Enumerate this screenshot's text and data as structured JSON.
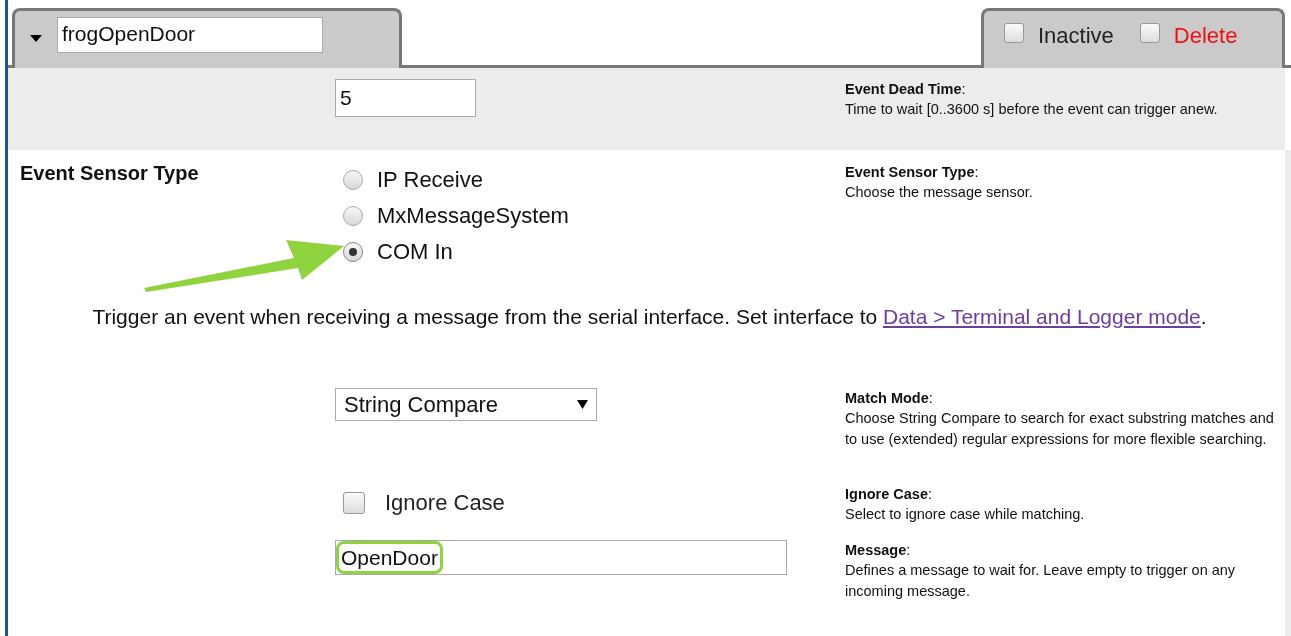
{
  "event_tab": {
    "name": "frogOpenDoor",
    "expanded": true
  },
  "tab_options": [
    {
      "label": "Inactive",
      "checked": false,
      "kind": "normal"
    },
    {
      "label": "Delete",
      "checked": false,
      "kind": "danger"
    }
  ],
  "dead_time": {
    "value": "5",
    "help_title": "**Event Dead Time**:",
    "help_text": "Time to wait [0..3600 s] before the event can trigger anew."
  },
  "sensor_type": {
    "label": "Event Sensor Type",
    "options": [
      {
        "label": "IP Receive",
        "selected": false
      },
      {
        "label": "MxMessageSystem",
        "selected": false
      },
      {
        "label": "COM In",
        "selected": true
      }
    ],
    "help_title": "**Event Sensor Type**:",
    "help_text": "Choose the message sensor."
  },
  "info": {
    "text": "Trigger an event when receiving a message from the serial interface. Set interface to",
    "link": "Data > Terminal and Logger mode",
    "after": "."
  },
  "match_mode": {
    "value": "String Compare",
    "help_title": "**Match Mode**:",
    "help_text": "Choose String Compare to search for exact substring matches and to use (extended) regular expressions for more flexible searching."
  },
  "ignore_case": {
    "label": "Ignore Case",
    "checked": false,
    "help_title": "**Ignore Case**:",
    "help_text": "Select to ignore case while matching."
  },
  "message": {
    "value": "OpenDoor",
    "highlighted": true,
    "help_title": "**Message**:",
    "help_text": "Defines a message to wait for. Leave empty to trigger on any incoming message."
  }
}
